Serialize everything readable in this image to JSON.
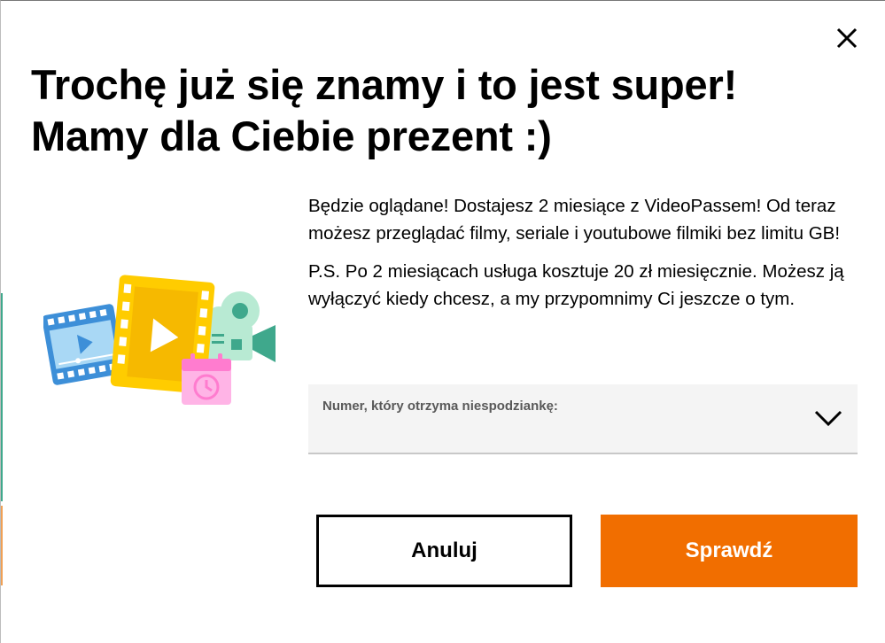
{
  "dialog": {
    "close_icon": "close-icon",
    "title_line1": "Trochę już się znamy i to jest super!",
    "title_line2": "Mamy dla Ciebie prezent :)",
    "paragraph1": "Będzie oglądane! Dostajesz 2 miesiące z VideoPassem! Od teraz możesz przeglądać filmy, seriale i youtubowe filmiki bez limitu GB!",
    "paragraph2": "P.S. Po 2 miesiącach usługa kosztuje 20 zł miesięcznie. Możesz ją wyłączyć kiedy chcesz, a my przypomnimy Ci jeszcze o tym.",
    "illustration_icons": [
      "film-strip-icon",
      "play-icon",
      "video-camera-icon",
      "calendar-clock-icon"
    ]
  },
  "number_select": {
    "label": "Numer, który otrzyma niespodziankę:",
    "value": "",
    "icon": "chevron-down-icon"
  },
  "buttons": {
    "cancel_label": "Anuluj",
    "check_label": "Sprawdź"
  },
  "colors": {
    "accent": "#f16e00",
    "text": "#000000",
    "field_bg": "#f4f4f4",
    "field_label": "#595959"
  }
}
